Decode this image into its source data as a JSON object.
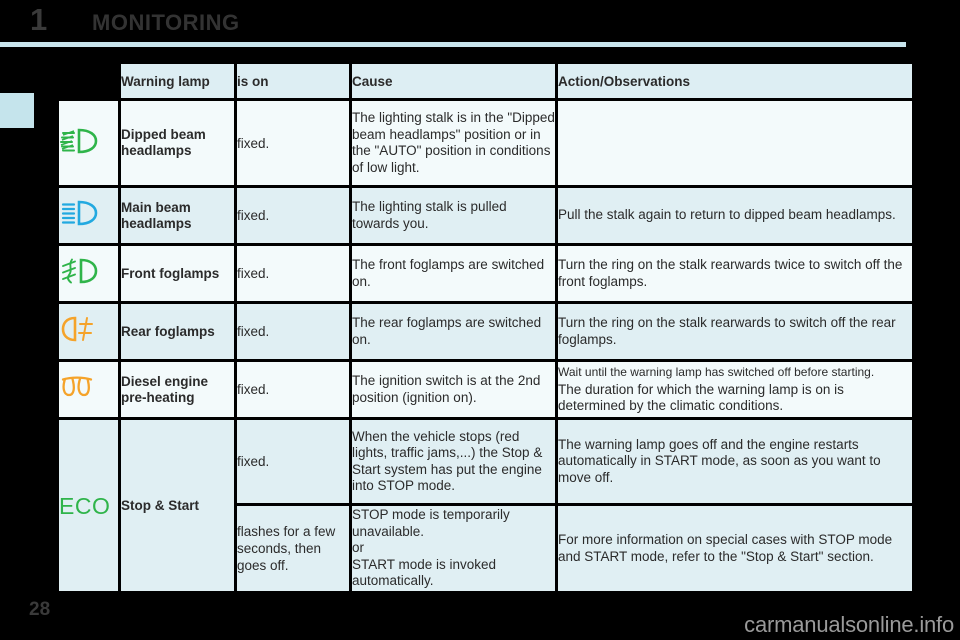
{
  "header": {
    "chapter_number": "1",
    "chapter_title": "MONITORING",
    "rule_color": "#c9e5ed"
  },
  "side_tab": {
    "color": "#c5e4ec"
  },
  "footer": {
    "page_number": "28",
    "watermark": "carmanualsonline.info"
  },
  "table": {
    "columns": [
      {
        "key": "icon",
        "label": ""
      },
      {
        "key": "lamp",
        "label": "Warning lamp"
      },
      {
        "key": "is_on",
        "label": "is on"
      },
      {
        "key": "cause",
        "label": "Cause"
      },
      {
        "key": "action",
        "label": "Action/Observations"
      }
    ],
    "rows": [
      {
        "icon_name": "dipped-beam-headlamps-icon",
        "icon_color": "#2fb44a",
        "lamp": "Dipped beam headlamps",
        "is_on": "fixed.",
        "cause": "The lighting stalk is in the \"Dipped beam headlamps\" position or in the \"AUTO\" position in conditions of low light.",
        "action": ""
      },
      {
        "icon_name": "main-beam-headlamps-icon",
        "icon_color": "#22a9e0",
        "lamp": "Main beam headlamps",
        "is_on": "fixed.",
        "cause": "The lighting stalk is pulled towards you.",
        "action": "Pull the stalk again to return to dipped beam headlamps."
      },
      {
        "icon_name": "front-foglamps-icon",
        "icon_color": "#2fb44a",
        "lamp": "Front foglamps",
        "is_on": "fixed.",
        "cause": "The front foglamps are switched on.",
        "action": "Turn the ring on the stalk rearwards twice to switch off the front foglamps."
      },
      {
        "icon_name": "rear-foglamps-icon",
        "icon_color": "#f5a32a",
        "lamp": "Rear foglamps",
        "is_on": "fixed.",
        "cause": "The rear foglamps are switched on.",
        "action": "Turn the ring on the stalk rearwards to switch off the rear foglamps."
      },
      {
        "icon_name": "diesel-preheating-icon",
        "icon_color": "#f5a32a",
        "lamp": "Diesel engine pre-heating",
        "is_on": "fixed.",
        "cause": "The ignition switch is at the 2nd position (ignition on).",
        "action_line1": "Wait until the warning lamp has switched off before starting.",
        "action_line2": "The duration for which the warning lamp is on is determined by the climatic conditions."
      }
    ],
    "stop_start": {
      "icon_name": "eco-icon",
      "icon_label": "ECO",
      "icon_color": "#2fb44a",
      "lamp": "Stop & Start",
      "sub_rows": [
        {
          "is_on": "fixed.",
          "cause": "When the vehicle stops (red lights, traffic jams,...) the Stop & Start system has put the engine into STOP mode.",
          "action": "The warning lamp goes off and the engine restarts automatically in START mode, as soon as you want to move off."
        },
        {
          "is_on": "flashes for a few seconds, then goes off.",
          "cause_line1": "STOP mode is temporarily unavailable.",
          "cause_line2": "or",
          "cause_line3": "START mode is invoked automatically.",
          "action": "For more information on special cases with STOP mode and START mode, refer to the \"Stop & Start\" section."
        }
      ]
    }
  }
}
